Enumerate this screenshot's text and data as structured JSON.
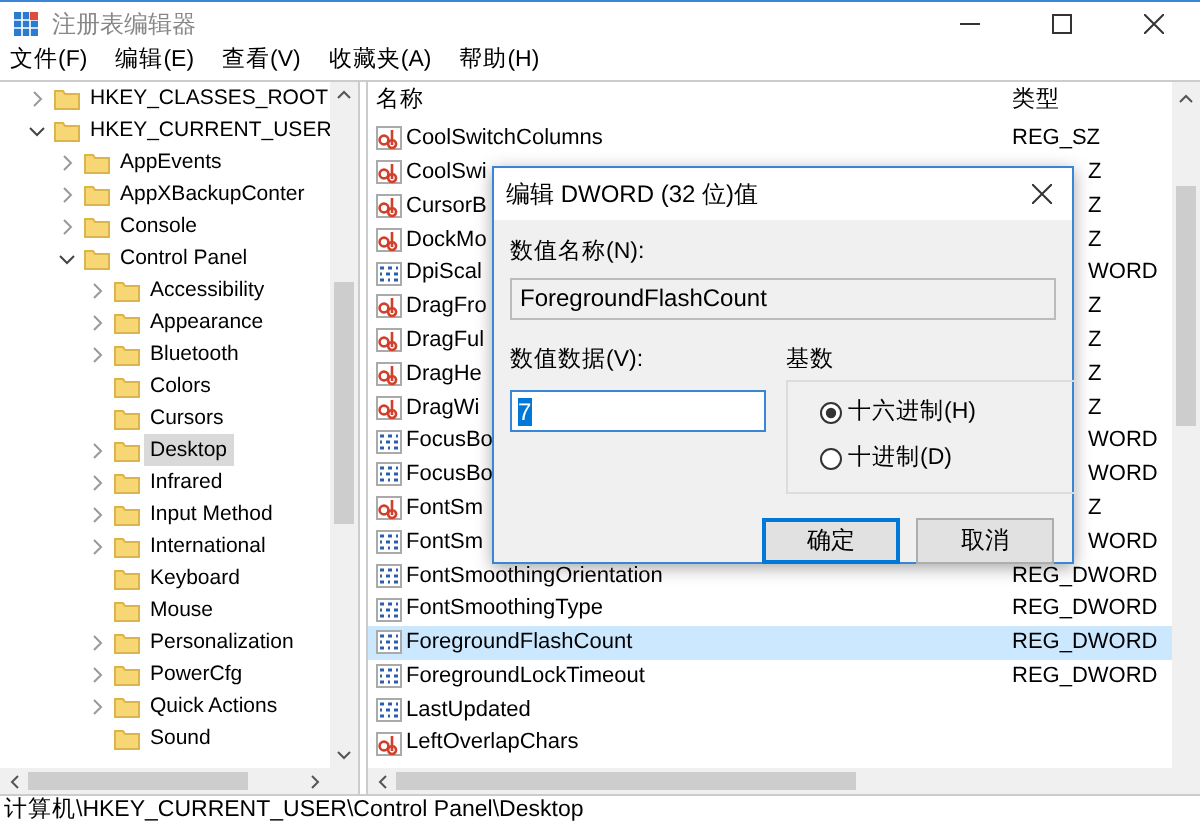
{
  "window": {
    "title": "注册表编辑器"
  },
  "menu": [
    "文件(F)",
    "编辑(E)",
    "查看(V)",
    "收藏夹(A)",
    "帮助(H)"
  ],
  "tree": [
    {
      "label": "HKEY_CLASSES_ROOT",
      "expanded": false,
      "selected": false
    },
    {
      "label": "HKEY_CURRENT_USER",
      "expanded": true,
      "selected": false,
      "children": [
        {
          "label": "AppEvents",
          "expanded": false,
          "selected": false
        },
        {
          "label": "AppXBackupConter",
          "expanded": false,
          "selected": false
        },
        {
          "label": "Console",
          "expanded": false,
          "selected": false
        },
        {
          "label": "Control Panel",
          "expanded": true,
          "selected": false,
          "children": [
            {
              "label": "Accessibility",
              "expanded": false,
              "selected": false
            },
            {
              "label": "Appearance",
              "expanded": false,
              "selected": false
            },
            {
              "label": "Bluetooth",
              "expanded": false,
              "selected": false
            },
            {
              "label": "Colors",
              "selected": false
            },
            {
              "label": "Cursors",
              "selected": false
            },
            {
              "label": "Desktop",
              "expanded": false,
              "selected": true
            },
            {
              "label": "Infrared",
              "expanded": false,
              "selected": false
            },
            {
              "label": "Input Method",
              "expanded": false,
              "selected": false
            },
            {
              "label": "International",
              "expanded": false,
              "selected": false
            },
            {
              "label": "Keyboard",
              "selected": false
            },
            {
              "label": "Mouse",
              "selected": false
            },
            {
              "label": "Personalization",
              "expanded": false,
              "selected": false
            },
            {
              "label": "PowerCfg",
              "expanded": false,
              "selected": false
            },
            {
              "label": "Quick Actions",
              "expanded": false,
              "selected": false
            },
            {
              "label": "Sound",
              "selected": false
            }
          ]
        }
      ]
    }
  ],
  "list": {
    "columns": [
      "名称",
      "类型"
    ],
    "rows": [
      {
        "name": "CoolSwitchColumns",
        "type": "REG_SZ",
        "kind": "string",
        "selected": false
      },
      {
        "name": "CoolSwi",
        "type": "Z",
        "kind": "string",
        "selected": false
      },
      {
        "name": "CursorB",
        "type": "Z",
        "kind": "string",
        "selected": false
      },
      {
        "name": "DockMo",
        "type": "Z",
        "kind": "string",
        "selected": false
      },
      {
        "name": "DpiScal",
        "type": "WORD",
        "kind": "dword",
        "selected": false
      },
      {
        "name": "DragFro",
        "type": "Z",
        "kind": "string",
        "selected": false
      },
      {
        "name": "DragFul",
        "type": "Z",
        "kind": "string",
        "selected": false
      },
      {
        "name": "DragHe",
        "type": "Z",
        "kind": "string",
        "selected": false
      },
      {
        "name": "DragWi",
        "type": "Z",
        "kind": "string",
        "selected": false
      },
      {
        "name": "FocusBo",
        "type": "WORD",
        "kind": "dword",
        "selected": false
      },
      {
        "name": "FocusBo",
        "type": "WORD",
        "kind": "dword",
        "selected": false
      },
      {
        "name": "FontSm",
        "type": "Z",
        "kind": "string",
        "selected": false
      },
      {
        "name": "FontSm",
        "type": "WORD",
        "kind": "dword",
        "selected": false
      },
      {
        "name": "FontSmoothingOrientation",
        "type": "REG_DWORD",
        "kind": "dword",
        "selected": false
      },
      {
        "name": "FontSmoothingType",
        "type": "REG_DWORD",
        "kind": "dword",
        "selected": false
      },
      {
        "name": "ForegroundFlashCount",
        "type": "REG_DWORD",
        "kind": "dword",
        "selected": true
      },
      {
        "name": "ForegroundLockTimeout",
        "type": "REG_DWORD",
        "kind": "dword",
        "selected": false
      },
      {
        "name": "LastUpdated",
        "kind": "dword",
        "selected": false
      },
      {
        "name": "LeftOverlapChars",
        "kind": "string",
        "selected": false
      }
    ]
  },
  "dialog": {
    "title": "编辑 DWORD (32 位)值",
    "name_label": "数值名称(N):",
    "name_value": "ForegroundFlashCount",
    "data_label": "数值数据(V):",
    "data_value": "7",
    "base_label": "基数",
    "radios": [
      {
        "label": "十六进制(H)",
        "selected": true
      },
      {
        "label": "十进制(D)",
        "selected": false
      }
    ],
    "buttons": [
      {
        "label": "确定",
        "default": true
      },
      {
        "label": "取消",
        "default": false
      }
    ]
  },
  "status_bar": "计算机\\HKEY_CURRENT_USER\\Control Panel\\Desktop"
}
